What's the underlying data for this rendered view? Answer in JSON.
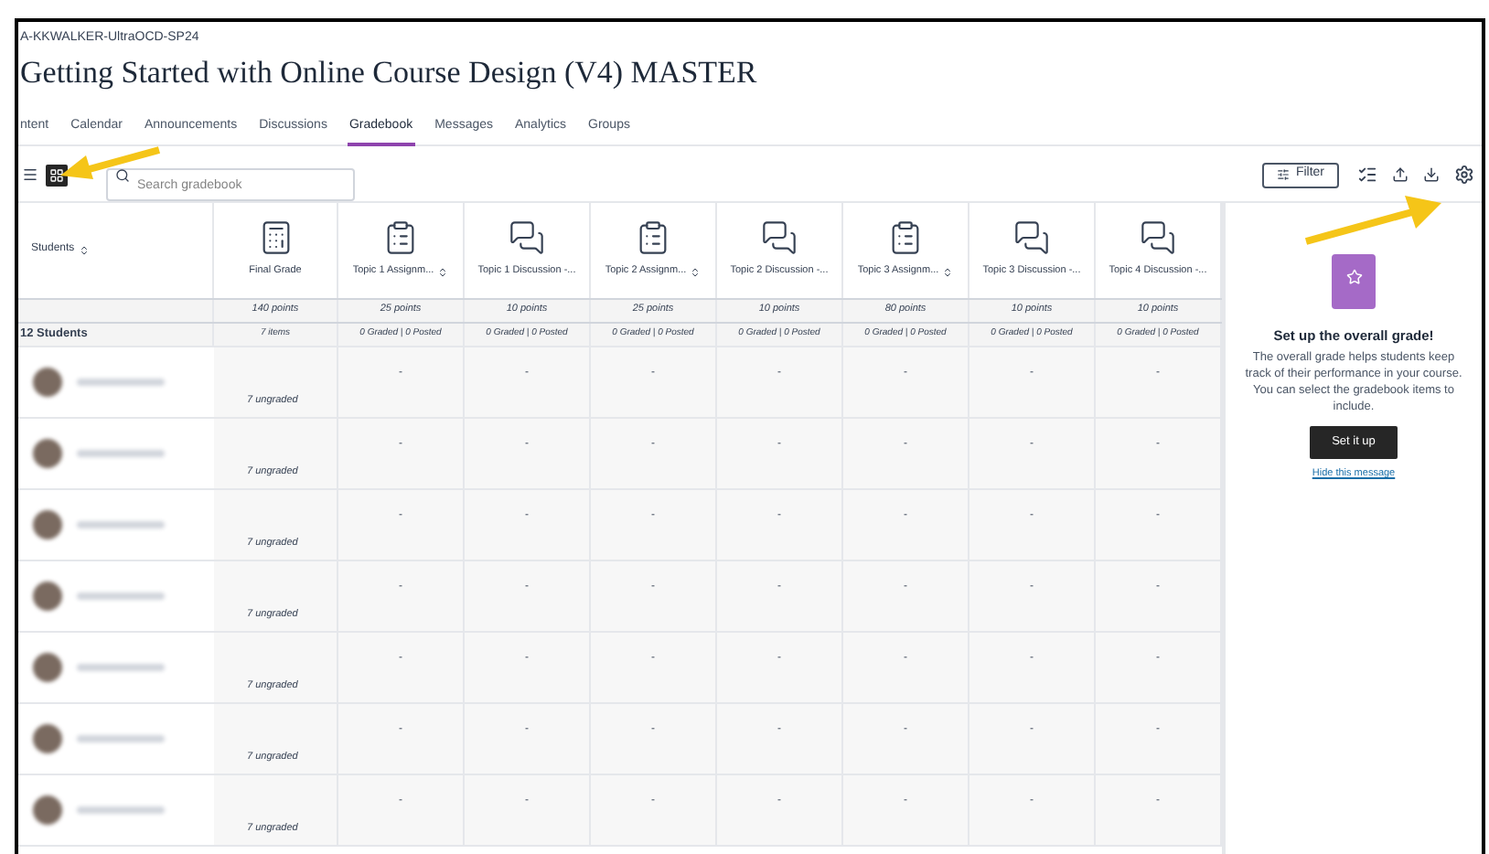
{
  "breadcrumb": "A-KKWALKER-UltraOCD-SP24",
  "title": "Getting Started with Online Course Design (V4) MASTER",
  "tabs": [
    {
      "label": "ntent",
      "selected": false
    },
    {
      "label": "Calendar",
      "selected": false
    },
    {
      "label": "Announcements",
      "selected": false
    },
    {
      "label": "Discussions",
      "selected": false
    },
    {
      "label": "Gradebook",
      "selected": true
    },
    {
      "label": "Messages",
      "selected": false
    },
    {
      "label": "Analytics",
      "selected": false
    },
    {
      "label": "Groups",
      "selected": false
    }
  ],
  "toolbar": {
    "views": [
      {
        "kind": "list",
        "selected": false
      },
      {
        "kind": "grid",
        "selected": true
      }
    ],
    "search": {
      "placeholder": "Search gradebook"
    },
    "filter": "Filter"
  },
  "table": {
    "students_header": {
      "label": "Students",
      "sortable": true
    },
    "summary_label": "12 Students",
    "columns": [
      {
        "kind": "grade",
        "label": "Final Grade",
        "sortable": false,
        "points": "140 points",
        "summary": "7 items"
      },
      {
        "kind": "assignment",
        "label": "Topic 1 Assignm...",
        "sortable": true,
        "points": "25 points",
        "summary": "0 Graded | 0 Posted"
      },
      {
        "kind": "discussion",
        "label": "Topic 1 Discussion -...",
        "sortable": false,
        "points": "10 points",
        "summary": "0 Graded | 0 Posted"
      },
      {
        "kind": "assignment",
        "label": "Topic 2 Assignm...",
        "sortable": true,
        "points": "25 points",
        "summary": "0 Graded | 0 Posted"
      },
      {
        "kind": "discussion",
        "label": "Topic 2 Discussion -...",
        "sortable": false,
        "points": "10 points",
        "summary": "0 Graded | 0 Posted"
      },
      {
        "kind": "assignment",
        "label": "Topic 3 Assignm...",
        "sortable": true,
        "points": "80 points",
        "summary": "0 Graded | 0 Posted"
      },
      {
        "kind": "discussion",
        "label": "Topic 3 Discussion -...",
        "sortable": false,
        "points": "10 points",
        "summary": "0 Graded | 0 Posted"
      },
      {
        "kind": "discussion",
        "label": "Topic 4 Discussion -...",
        "sortable": false,
        "points": "10 points",
        "summary": "0 Graded | 0 Posted"
      }
    ],
    "rows": [
      {
        "cells": [
          "7 ungraded",
          "-",
          "-",
          "-",
          "-",
          "-",
          "-",
          "-"
        ]
      },
      {
        "cells": [
          "7 ungraded",
          "-",
          "-",
          "-",
          "-",
          "-",
          "-",
          "-"
        ]
      },
      {
        "cells": [
          "7 ungraded",
          "-",
          "-",
          "-",
          "-",
          "-",
          "-",
          "-"
        ]
      },
      {
        "cells": [
          "7 ungraded",
          "-",
          "-",
          "-",
          "-",
          "-",
          "-",
          "-"
        ]
      },
      {
        "cells": [
          "7 ungraded",
          "-",
          "-",
          "-",
          "-",
          "-",
          "-",
          "-"
        ]
      },
      {
        "cells": [
          "7 ungraded",
          "-",
          "-",
          "-",
          "-",
          "-",
          "-",
          "-"
        ]
      },
      {
        "cells": [
          "7 ungraded",
          "-",
          "-",
          "-",
          "-",
          "-",
          "-",
          "-"
        ]
      }
    ]
  },
  "panel": {
    "heading": "Set up the overall grade!",
    "text": "The overall grade helps students keep track of their performance in your course. You can select the gradebook items to include.",
    "button": "Set it up",
    "link": "Hide this message"
  }
}
